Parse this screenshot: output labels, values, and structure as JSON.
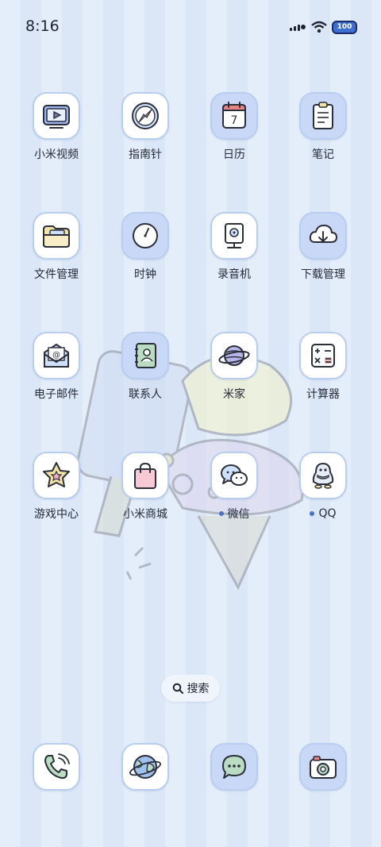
{
  "status_bar": {
    "time": "8:16",
    "battery": "100",
    "icons": [
      "signal-icon",
      "wifi-icon",
      "battery-icon"
    ]
  },
  "apps": [
    {
      "label": "小米视频",
      "icon": "video-icon"
    },
    {
      "label": "指南针",
      "icon": "compass-icon"
    },
    {
      "label": "日历",
      "icon": "calendar-icon",
      "calendar_day": "7"
    },
    {
      "label": "笔记",
      "icon": "notes-icon"
    },
    {
      "label": "文件管理",
      "icon": "folder-icon"
    },
    {
      "label": "时钟",
      "icon": "clock-icon"
    },
    {
      "label": "录音机",
      "icon": "recorder-icon"
    },
    {
      "label": "下载管理",
      "icon": "download-icon"
    },
    {
      "label": "电子邮件",
      "icon": "mail-icon"
    },
    {
      "label": "联系人",
      "icon": "contacts-icon"
    },
    {
      "label": "米家",
      "icon": "planet-icon"
    },
    {
      "label": "计算器",
      "icon": "calculator-icon"
    },
    {
      "label": "游戏中心",
      "icon": "star-icon"
    },
    {
      "label": "小米商城",
      "icon": "shopping-bag-icon"
    },
    {
      "label": "微信",
      "icon": "wechat-icon",
      "new_dot": true
    },
    {
      "label": "QQ",
      "icon": "qq-penguin-icon",
      "new_dot": true
    }
  ],
  "search": {
    "label": "搜索",
    "icon": "search-icon"
  },
  "dock": [
    {
      "icon": "phone-icon"
    },
    {
      "icon": "browser-globe-icon"
    },
    {
      "icon": "messages-icon"
    },
    {
      "icon": "camera-icon"
    }
  ],
  "colors": {
    "accent": "#4a72c9",
    "tile_border": "#b9cdf0",
    "background": "#e4eefa"
  }
}
